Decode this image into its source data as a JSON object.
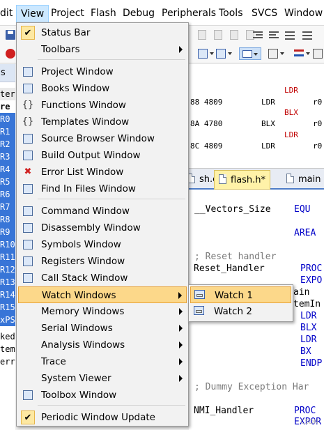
{
  "menubar": {
    "items": [
      "dit",
      "View",
      "Project",
      "Flash",
      "Debug",
      "Peripherals",
      "Tools",
      "SVCS",
      "Window"
    ]
  },
  "left_panel": {
    "tab_label": "s",
    "header": "ter",
    "col_label": "re",
    "rows": [
      "R0",
      "R1",
      "R2",
      "R3",
      "R4",
      "R5",
      "R6",
      "R7",
      "R8",
      "R9",
      "R10",
      "R11",
      "R12",
      "R13",
      "R14",
      "R15",
      "xPS"
    ],
    "extra": [
      "ked",
      "tem",
      "err"
    ]
  },
  "disassembly": {
    "lines": [
      {
        "a": "",
        "b": "",
        "c": "LDR",
        "d": ""
      },
      {
        "a": "88 4809",
        "b": "LDR",
        "c": "",
        "d": "r0"
      },
      {
        "a": "",
        "b": "",
        "c": "BLX",
        "d": ""
      },
      {
        "a": "8A 4780",
        "b": "BLX",
        "c": "",
        "d": "r0"
      },
      {
        "a": "",
        "b": "",
        "c": "LDR",
        "d": ""
      },
      {
        "a": "8C 4809",
        "b": "LDR",
        "c": "",
        "d": "r0"
      }
    ]
  },
  "editor_tabs": [
    "sh.c",
    "flash.h*",
    "main"
  ],
  "editor": {
    "lines": [
      {
        "t": "__Vectors_Size",
        "k": "EQU"
      },
      {
        "t": "",
        "k": "AREA"
      },
      {
        "c": "; Reset handler"
      },
      {
        "t": "Reset_Handler",
        "k": "PROC"
      },
      {
        "t": "",
        "k": "EXPO"
      },
      {
        "t": "ain",
        "k": ""
      },
      {
        "t": "temIn",
        "k": ""
      },
      {
        "t": "",
        "k": "LDR"
      },
      {
        "t": "",
        "k": "BLX"
      },
      {
        "t": "",
        "k": "LDR"
      },
      {
        "t": "",
        "k": "BX"
      },
      {
        "t": "",
        "k": "ENDP"
      },
      {
        "c": "; Dummy Exception Har"
      },
      {
        "t": "NMI_Handler",
        "k": "PROC"
      },
      {
        "t": "",
        "k": "EXPOR"
      }
    ]
  },
  "view_menu": {
    "items": [
      {
        "label": "Status Bar",
        "icon": "checkmark-icon",
        "checked": true
      },
      {
        "label": "Toolbars",
        "icon": "",
        "submenu": true
      },
      {
        "label": "Project Window",
        "icon": "project-window-icon"
      },
      {
        "label": "Books Window",
        "icon": "books-window-icon"
      },
      {
        "label": "Functions Window",
        "icon": "functions-window-icon"
      },
      {
        "label": "Templates Window",
        "icon": "templates-window-icon"
      },
      {
        "label": "Source Browser Window",
        "icon": "source-browser-icon"
      },
      {
        "label": "Build Output Window",
        "icon": "build-output-icon"
      },
      {
        "label": "Error List Window",
        "icon": "error-list-icon"
      },
      {
        "label": "Find In Files Window",
        "icon": "find-in-files-icon"
      },
      {
        "label": "Command Window",
        "icon": "command-window-icon"
      },
      {
        "label": "Disassembly Window",
        "icon": "disassembly-window-icon"
      },
      {
        "label": "Symbols Window",
        "icon": "symbols-window-icon"
      },
      {
        "label": "Registers Window",
        "icon": "registers-window-icon"
      },
      {
        "label": "Call Stack Window",
        "icon": "call-stack-icon"
      },
      {
        "label": "Watch Windows",
        "icon": "",
        "submenu": true,
        "highlighted": true
      },
      {
        "label": "Memory Windows",
        "icon": "",
        "submenu": true
      },
      {
        "label": "Serial Windows",
        "icon": "",
        "submenu": true
      },
      {
        "label": "Analysis Windows",
        "icon": "",
        "submenu": true
      },
      {
        "label": "Trace",
        "icon": "",
        "submenu": true
      },
      {
        "label": "System Viewer",
        "icon": "",
        "submenu": true
      },
      {
        "label": "Toolbox Window",
        "icon": "toolbox-icon"
      },
      {
        "label": "Periodic Window Update",
        "icon": "checkmark-icon",
        "checked": true
      }
    ]
  },
  "watch_submenu": {
    "items": [
      {
        "label": "Watch 1",
        "icon": "watch-window-icon",
        "highlighted": true
      },
      {
        "label": "Watch 2",
        "icon": "watch-window-icon"
      }
    ]
  },
  "watermark": "CSDN",
  "colors": {
    "menu_highlight": "#fcd88a",
    "selection_blue": "#3875d7",
    "keyword_blue": "#0000c8",
    "disasm_red": "#c00000"
  }
}
